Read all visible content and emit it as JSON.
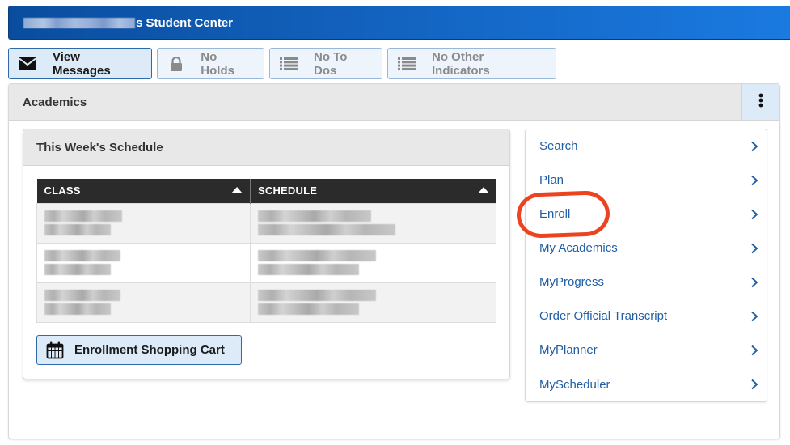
{
  "title_bar": {
    "name_redacted": true,
    "title_suffix": "s Student Center"
  },
  "indicators": [
    {
      "label": "View Messages",
      "icon": "envelope-icon",
      "active": true
    },
    {
      "label": "No Holds",
      "icon": "lock-icon",
      "active": false
    },
    {
      "label": "No To Dos",
      "icon": "list-icon",
      "active": false
    },
    {
      "label": "No Other Indicators",
      "icon": "list-icon",
      "active": false
    }
  ],
  "academics": {
    "title": "Academics",
    "menu_icon": "kebab-vertical-icon",
    "schedule": {
      "title": "This Week's Schedule",
      "columns": [
        "CLASS",
        "SCHEDULE"
      ],
      "rows": [
        {
          "class": "[redacted]",
          "schedule": "[redacted]"
        },
        {
          "class": "[redacted]",
          "schedule": "[redacted]"
        },
        {
          "class": "[redacted]",
          "schedule": "[redacted]"
        }
      ],
      "cart_button": {
        "label": "Enrollment Shopping Cart",
        "icon": "calendar-icon"
      }
    },
    "nav_links": [
      {
        "label": "Search",
        "highlighted": false
      },
      {
        "label": "Plan",
        "highlighted": false
      },
      {
        "label": "Enroll",
        "highlighted": true
      },
      {
        "label": "My Academics",
        "highlighted": false
      },
      {
        "label": "MyProgress",
        "highlighted": false
      },
      {
        "label": "Order Official Transcript",
        "highlighted": false
      },
      {
        "label": "MyPlanner",
        "highlighted": false
      },
      {
        "label": "MyScheduler",
        "highlighted": false
      }
    ]
  },
  "colors": {
    "header_start": "#0a4d9e",
    "header_end": "#1a7ae0",
    "link": "#1f5fa6",
    "annotation": "#ec4420",
    "button_bg": "#dcebf7",
    "table_header": "#2b2b2b"
  }
}
